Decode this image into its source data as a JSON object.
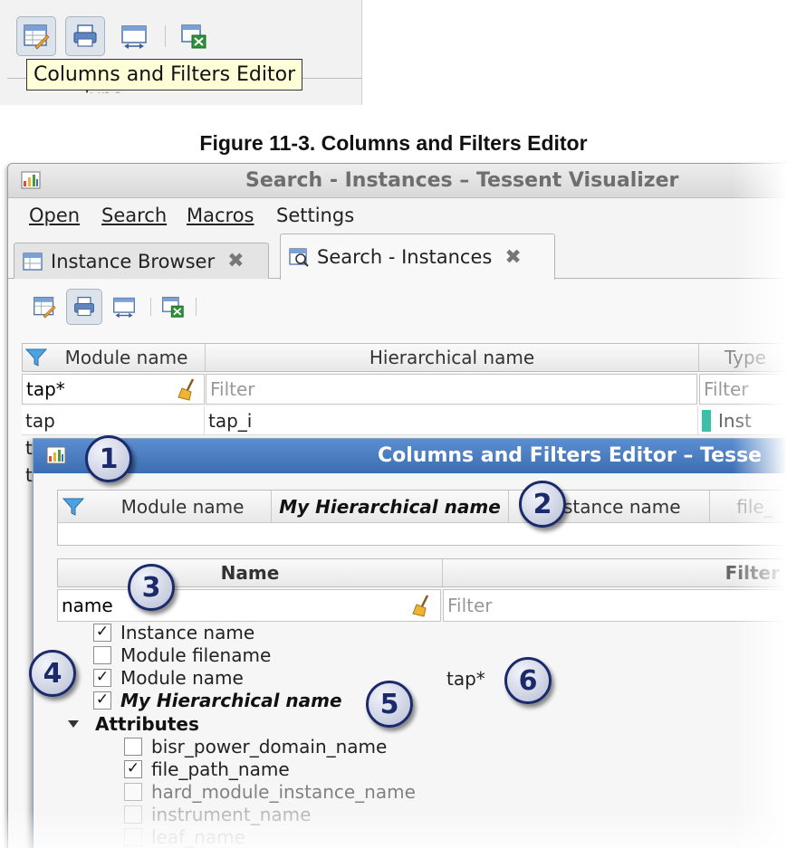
{
  "snippet": {
    "tooltip": "Columns and Filters Editor",
    "table_header_partial": "Type",
    "toolbar_icons": [
      "columns-filters-editor-icon",
      "print-icon",
      "fit-columns-icon",
      "export-excel-icon"
    ]
  },
  "caption": "Figure 11-3. Columns and Filters Editor",
  "window": {
    "title": "Search - Instances – Tessent Visualizer",
    "menu": [
      "Open",
      "Search",
      "Macros",
      "Settings"
    ],
    "tabs": [
      {
        "label": "Instance Browser",
        "active": false
      },
      {
        "label": "Search - Instances",
        "active": true
      }
    ],
    "table": {
      "headers": [
        "Module name",
        "Hierarchical name",
        "Type"
      ],
      "filters": [
        {
          "value": "tap*",
          "placeholder": ""
        },
        {
          "value": "",
          "placeholder": "Filter"
        },
        {
          "value": "",
          "placeholder": "Filter"
        }
      ],
      "rows": [
        [
          "tap",
          "tap_i",
          "Inst"
        ]
      ],
      "partial_rows": [
        "t",
        "t"
      ]
    }
  },
  "dialog": {
    "title": "Columns and Filters Editor – Tesse",
    "preview_headers": [
      "Module name",
      "My Hierarchical name",
      "Instance name",
      "file_"
    ],
    "name_table": {
      "headers": [
        "Name",
        "Filter"
      ],
      "name_filter_value": "name",
      "filter_placeholder": "Filter"
    },
    "items": [
      {
        "label": "Instance name",
        "checked": true
      },
      {
        "label": "Module filename",
        "checked": false
      },
      {
        "label": "Module name",
        "checked": true,
        "filter": "tap*"
      },
      {
        "label": "My Hierarchical name",
        "checked": true
      },
      {
        "label": "Attributes",
        "group": true
      },
      {
        "label": "bisr_power_domain_name",
        "checked": false
      },
      {
        "label": "file_path_name",
        "checked": true
      },
      {
        "label": "hard_module_instance_name",
        "checked": false
      },
      {
        "label": "instrument_name",
        "checked": false
      },
      {
        "label": "leaf_name",
        "checked": false
      }
    ],
    "check_mark": "✓"
  },
  "callouts": [
    "1",
    "2",
    "3",
    "4",
    "5",
    "6"
  ],
  "colors": {
    "dialog_title_bar": "#4a7dc2",
    "callout_border": "#1a2a6b",
    "type_badge": "#3cbfa8"
  }
}
